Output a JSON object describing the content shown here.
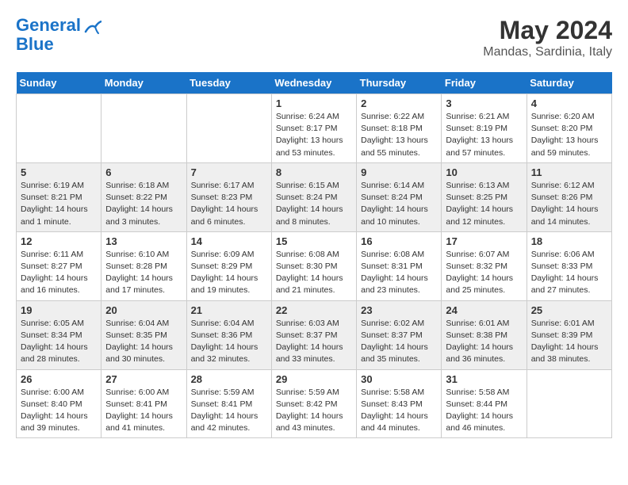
{
  "logo": {
    "line1": "General",
    "line2": "Blue"
  },
  "title": "May 2024",
  "location": "Mandas, Sardinia, Italy",
  "days_of_week": [
    "Sunday",
    "Monday",
    "Tuesday",
    "Wednesday",
    "Thursday",
    "Friday",
    "Saturday"
  ],
  "weeks": [
    [
      {
        "day": "",
        "sunrise": "",
        "sunset": "",
        "daylight": ""
      },
      {
        "day": "",
        "sunrise": "",
        "sunset": "",
        "daylight": ""
      },
      {
        "day": "",
        "sunrise": "",
        "sunset": "",
        "daylight": ""
      },
      {
        "day": "1",
        "sunrise": "Sunrise: 6:24 AM",
        "sunset": "Sunset: 8:17 PM",
        "daylight": "Daylight: 13 hours and 53 minutes."
      },
      {
        "day": "2",
        "sunrise": "Sunrise: 6:22 AM",
        "sunset": "Sunset: 8:18 PM",
        "daylight": "Daylight: 13 hours and 55 minutes."
      },
      {
        "day": "3",
        "sunrise": "Sunrise: 6:21 AM",
        "sunset": "Sunset: 8:19 PM",
        "daylight": "Daylight: 13 hours and 57 minutes."
      },
      {
        "day": "4",
        "sunrise": "Sunrise: 6:20 AM",
        "sunset": "Sunset: 8:20 PM",
        "daylight": "Daylight: 13 hours and 59 minutes."
      }
    ],
    [
      {
        "day": "5",
        "sunrise": "Sunrise: 6:19 AM",
        "sunset": "Sunset: 8:21 PM",
        "daylight": "Daylight: 14 hours and 1 minute."
      },
      {
        "day": "6",
        "sunrise": "Sunrise: 6:18 AM",
        "sunset": "Sunset: 8:22 PM",
        "daylight": "Daylight: 14 hours and 3 minutes."
      },
      {
        "day": "7",
        "sunrise": "Sunrise: 6:17 AM",
        "sunset": "Sunset: 8:23 PM",
        "daylight": "Daylight: 14 hours and 6 minutes."
      },
      {
        "day": "8",
        "sunrise": "Sunrise: 6:15 AM",
        "sunset": "Sunset: 8:24 PM",
        "daylight": "Daylight: 14 hours and 8 minutes."
      },
      {
        "day": "9",
        "sunrise": "Sunrise: 6:14 AM",
        "sunset": "Sunset: 8:24 PM",
        "daylight": "Daylight: 14 hours and 10 minutes."
      },
      {
        "day": "10",
        "sunrise": "Sunrise: 6:13 AM",
        "sunset": "Sunset: 8:25 PM",
        "daylight": "Daylight: 14 hours and 12 minutes."
      },
      {
        "day": "11",
        "sunrise": "Sunrise: 6:12 AM",
        "sunset": "Sunset: 8:26 PM",
        "daylight": "Daylight: 14 hours and 14 minutes."
      }
    ],
    [
      {
        "day": "12",
        "sunrise": "Sunrise: 6:11 AM",
        "sunset": "Sunset: 8:27 PM",
        "daylight": "Daylight: 14 hours and 16 minutes."
      },
      {
        "day": "13",
        "sunrise": "Sunrise: 6:10 AM",
        "sunset": "Sunset: 8:28 PM",
        "daylight": "Daylight: 14 hours and 17 minutes."
      },
      {
        "day": "14",
        "sunrise": "Sunrise: 6:09 AM",
        "sunset": "Sunset: 8:29 PM",
        "daylight": "Daylight: 14 hours and 19 minutes."
      },
      {
        "day": "15",
        "sunrise": "Sunrise: 6:08 AM",
        "sunset": "Sunset: 8:30 PM",
        "daylight": "Daylight: 14 hours and 21 minutes."
      },
      {
        "day": "16",
        "sunrise": "Sunrise: 6:08 AM",
        "sunset": "Sunset: 8:31 PM",
        "daylight": "Daylight: 14 hours and 23 minutes."
      },
      {
        "day": "17",
        "sunrise": "Sunrise: 6:07 AM",
        "sunset": "Sunset: 8:32 PM",
        "daylight": "Daylight: 14 hours and 25 minutes."
      },
      {
        "day": "18",
        "sunrise": "Sunrise: 6:06 AM",
        "sunset": "Sunset: 8:33 PM",
        "daylight": "Daylight: 14 hours and 27 minutes."
      }
    ],
    [
      {
        "day": "19",
        "sunrise": "Sunrise: 6:05 AM",
        "sunset": "Sunset: 8:34 PM",
        "daylight": "Daylight: 14 hours and 28 minutes."
      },
      {
        "day": "20",
        "sunrise": "Sunrise: 6:04 AM",
        "sunset": "Sunset: 8:35 PM",
        "daylight": "Daylight: 14 hours and 30 minutes."
      },
      {
        "day": "21",
        "sunrise": "Sunrise: 6:04 AM",
        "sunset": "Sunset: 8:36 PM",
        "daylight": "Daylight: 14 hours and 32 minutes."
      },
      {
        "day": "22",
        "sunrise": "Sunrise: 6:03 AM",
        "sunset": "Sunset: 8:37 PM",
        "daylight": "Daylight: 14 hours and 33 minutes."
      },
      {
        "day": "23",
        "sunrise": "Sunrise: 6:02 AM",
        "sunset": "Sunset: 8:37 PM",
        "daylight": "Daylight: 14 hours and 35 minutes."
      },
      {
        "day": "24",
        "sunrise": "Sunrise: 6:01 AM",
        "sunset": "Sunset: 8:38 PM",
        "daylight": "Daylight: 14 hours and 36 minutes."
      },
      {
        "day": "25",
        "sunrise": "Sunrise: 6:01 AM",
        "sunset": "Sunset: 8:39 PM",
        "daylight": "Daylight: 14 hours and 38 minutes."
      }
    ],
    [
      {
        "day": "26",
        "sunrise": "Sunrise: 6:00 AM",
        "sunset": "Sunset: 8:40 PM",
        "daylight": "Daylight: 14 hours and 39 minutes."
      },
      {
        "day": "27",
        "sunrise": "Sunrise: 6:00 AM",
        "sunset": "Sunset: 8:41 PM",
        "daylight": "Daylight: 14 hours and 41 minutes."
      },
      {
        "day": "28",
        "sunrise": "Sunrise: 5:59 AM",
        "sunset": "Sunset: 8:41 PM",
        "daylight": "Daylight: 14 hours and 42 minutes."
      },
      {
        "day": "29",
        "sunrise": "Sunrise: 5:59 AM",
        "sunset": "Sunset: 8:42 PM",
        "daylight": "Daylight: 14 hours and 43 minutes."
      },
      {
        "day": "30",
        "sunrise": "Sunrise: 5:58 AM",
        "sunset": "Sunset: 8:43 PM",
        "daylight": "Daylight: 14 hours and 44 minutes."
      },
      {
        "day": "31",
        "sunrise": "Sunrise: 5:58 AM",
        "sunset": "Sunset: 8:44 PM",
        "daylight": "Daylight: 14 hours and 46 minutes."
      },
      {
        "day": "",
        "sunrise": "",
        "sunset": "",
        "daylight": ""
      }
    ]
  ]
}
